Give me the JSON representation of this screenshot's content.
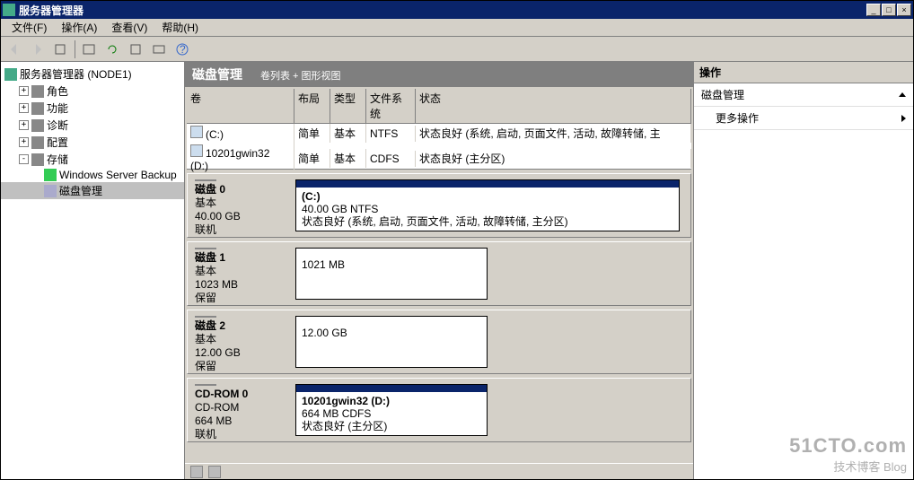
{
  "window": {
    "title": "服务器管理器"
  },
  "menu": {
    "file": "文件(F)",
    "action": "操作(A)",
    "view": "查看(V)",
    "help": "帮助(H)"
  },
  "tree": {
    "root": "服务器管理器 (NODE1)",
    "items": [
      {
        "label": "角色"
      },
      {
        "label": "功能"
      },
      {
        "label": "诊断"
      },
      {
        "label": "配置"
      },
      {
        "label": "存储",
        "expanded": true,
        "children": [
          {
            "label": "Windows Server Backup"
          },
          {
            "label": "磁盘管理"
          }
        ]
      }
    ]
  },
  "center": {
    "title": "磁盘管理",
    "subtitle": "卷列表 + 图形视图",
    "cols": {
      "vol": "卷",
      "layout": "布局",
      "type": "类型",
      "fs": "文件系统",
      "status": "状态"
    },
    "volumes": [
      {
        "name": "(C:)",
        "layout": "简单",
        "type": "基本",
        "fs": "NTFS",
        "status": "状态良好 (系统, 启动, 页面文件, 活动, 故障转储, 主"
      },
      {
        "name": "10201gwin32 (D:)",
        "layout": "简单",
        "type": "基本",
        "fs": "CDFS",
        "status": "状态良好 (主分区)"
      }
    ],
    "disks": [
      {
        "label": "磁盘 0",
        "kind": "基本",
        "size": "40.00 GB",
        "state": "联机",
        "parts": [
          {
            "name": "(C:)",
            "line2": "40.00 GB NTFS",
            "line3": "状态良好 (系统, 启动, 页面文件, 活动, 故障转储, 主分区)"
          }
        ]
      },
      {
        "label": "磁盘 1",
        "kind": "基本",
        "size": "1023 MB",
        "state": "保留",
        "parts": [
          {
            "name": "",
            "line2": "1021 MB",
            "line3": ""
          }
        ]
      },
      {
        "label": "磁盘 2",
        "kind": "基本",
        "size": "12.00 GB",
        "state": "保留",
        "parts": [
          {
            "name": "",
            "line2": "12.00 GB",
            "line3": ""
          }
        ]
      },
      {
        "label": "CD-ROM 0",
        "kind": "CD-ROM",
        "size": "664 MB",
        "state": "联机",
        "parts": [
          {
            "name": "10201gwin32  (D:)",
            "line2": "664 MB CDFS",
            "line3": "状态良好 (主分区)"
          }
        ]
      }
    ]
  },
  "actions": {
    "head": "操作",
    "section": "磁盘管理",
    "more": "更多操作"
  },
  "watermark": {
    "big": "51CTO.com",
    "sm": "技术博客  Blog"
  }
}
